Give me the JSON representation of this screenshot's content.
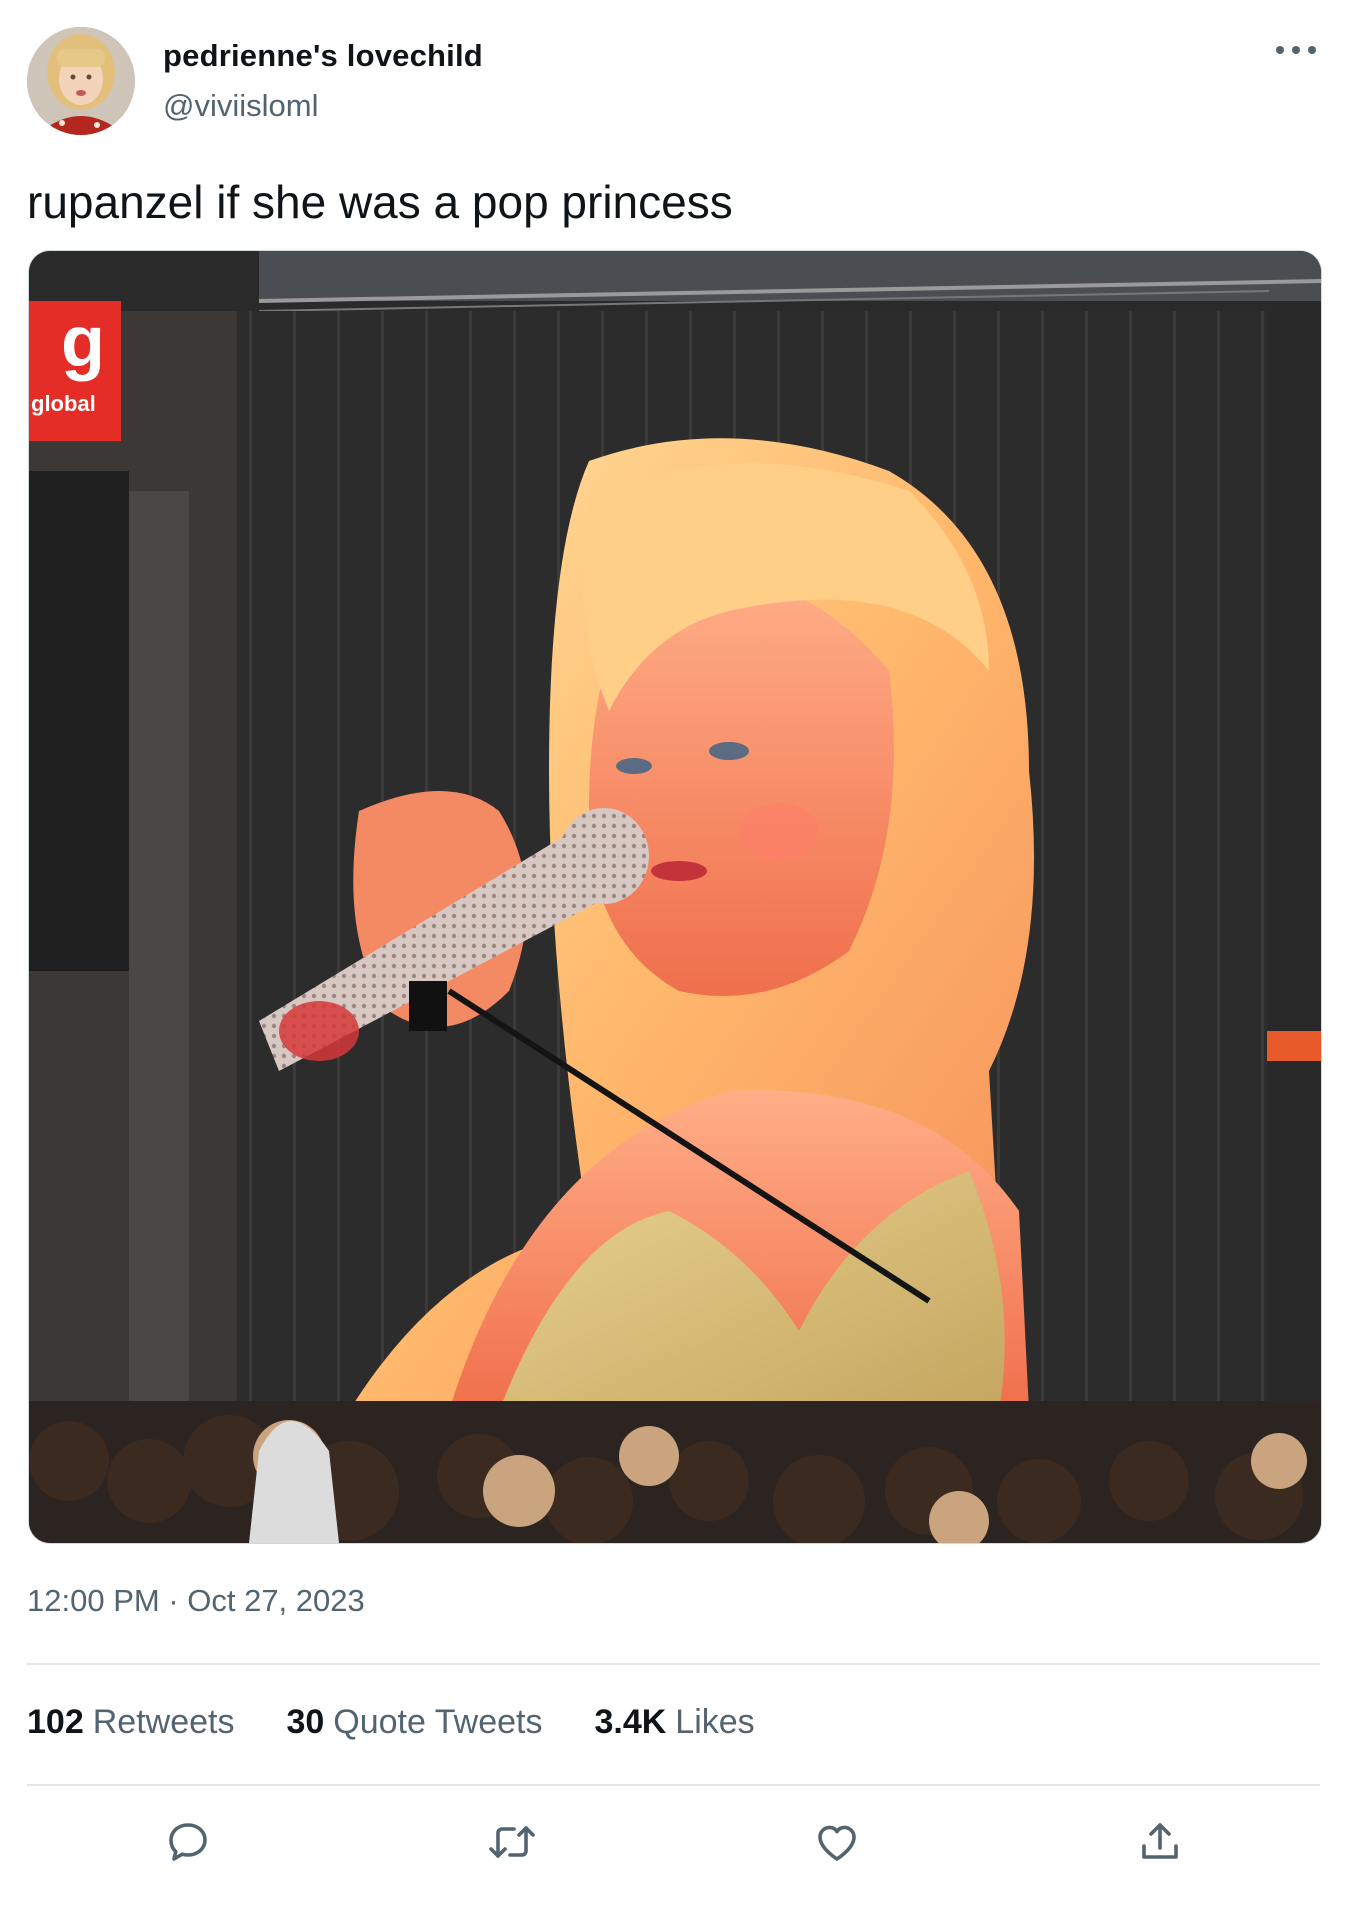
{
  "tweet": {
    "author": {
      "display_name": "pedrienne's lovechild",
      "handle": "@viviisloml"
    },
    "text": "rupanzel if she was a pop princess",
    "media": {
      "screen_logo_text": "global"
    },
    "timestamp": "12:00 PM · Oct 27, 2023",
    "stats": {
      "retweets": {
        "count": "102",
        "label": "Retweets"
      },
      "quote_tweets": {
        "count": "30",
        "label": "Quote Tweets"
      },
      "likes": {
        "count": "3.4K",
        "label": "Likes"
      }
    },
    "actions": [
      "reply-icon",
      "retweet-icon",
      "like-icon",
      "share-icon"
    ]
  },
  "colors": {
    "text_primary": "#0f1419",
    "text_secondary": "#536471",
    "divider": "#e1e6ea"
  }
}
